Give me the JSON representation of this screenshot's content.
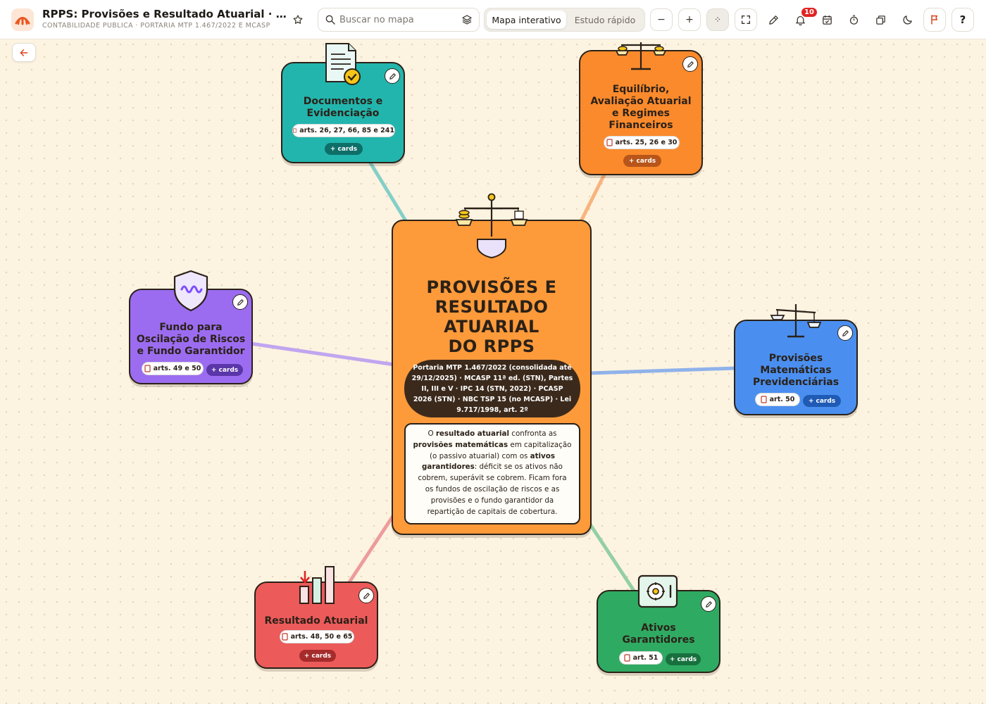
{
  "header": {
    "title": "RPPS: Provisões e Resultado Atuarial · Ativa...",
    "subtitle": "CONTABILIDADE PÚBLICA · PORTARIA MTP 1.467/2022 E MCASP",
    "search_placeholder": "Buscar no mapa",
    "modes": {
      "active": "Mapa interativo",
      "inactive": "Estudo rápido"
    },
    "zoom_out": "−",
    "zoom_in": "+",
    "zoom_center": "⁘",
    "notifications_count": "10",
    "help": "?"
  },
  "center": {
    "title_lines": [
      "PROVISÕES E",
      "RESULTADO",
      "ATUARIAL",
      "DO RPPS"
    ],
    "refs": "Portaria MTP 1.467/2022 (consolidada até 29/12/2025) · MCASP 11ª ed. (STN), Partes II, III e V · IPC 14 (STN, 2022) · PCASP 2026 (STN) · NBC TSP 15 (no MCASP) · Lei 9.717/1998, art. 2º",
    "desc_parts": [
      {
        "t": "O ",
        "b": false
      },
      {
        "t": "resultado atuarial",
        "b": true
      },
      {
        "t": " confronta as ",
        "b": false
      },
      {
        "t": "provisões matemáticas",
        "b": true
      },
      {
        "t": " em capitalização (o passivo atuarial) com os ",
        "b": false
      },
      {
        "t": "ativos garantidores",
        "b": true
      },
      {
        "t": ": déficit se os ativos não cobrem, superávit se cobrem. Ficam fora os fundos de oscilação de riscos e as provisões e o fundo garantidor da repartição de capitais de cobertura.",
        "b": false
      }
    ]
  },
  "nodes": {
    "documentos": {
      "title_lines": [
        "Documentos e",
        "Evidenciação"
      ],
      "articles": "arts. 26, 27, 66, 85 e 241",
      "cards": "+ cards",
      "color": "#22b5ad",
      "cards_color": "#0e6e68"
    },
    "equilibrio": {
      "title_lines": [
        "Equilíbrio,",
        "Avaliação Atuarial",
        "e Regimes",
        "Financeiros"
      ],
      "articles": "arts. 25, 26 e 30",
      "cards": "+ cards",
      "color": "#fb8a2c",
      "cards_color": "#b8551a"
    },
    "fundo": {
      "title_lines": [
        "Fundo para",
        "Oscilação de Riscos",
        "e Fundo Garantidor"
      ],
      "articles": "arts. 49 e 50",
      "cards": "+ cards",
      "color": "#9b6cf0",
      "cards_color": "#5a36a8"
    },
    "provisoes": {
      "title_lines": [
        "Provisões",
        "Matemáticas",
        "Previdenciárias"
      ],
      "articles": "art. 50",
      "cards": "+ cards",
      "color": "#4a8ff0",
      "cards_color": "#1f5bb5"
    },
    "resultado": {
      "title_lines": [
        "Resultado Atuarial"
      ],
      "articles": "arts. 48, 50 e 65",
      "cards": "+ cards",
      "color": "#ec5a5a",
      "cards_color": "#a62c2c"
    },
    "ativos": {
      "title_lines": [
        "Ativos",
        "Garantidores"
      ],
      "articles": "art. 51",
      "cards": "+ cards",
      "color": "#2faa62",
      "cards_color": "#17703d"
    }
  },
  "links": {
    "documentos": "#84cfc8",
    "equilibrio": "#f8b47e",
    "fundo": "#c0a6ef",
    "provisoes": "#8fb2ea",
    "resultado": "#ec9c9c",
    "ativos": "#93cfa5"
  },
  "center_color": "#fd9a3a"
}
